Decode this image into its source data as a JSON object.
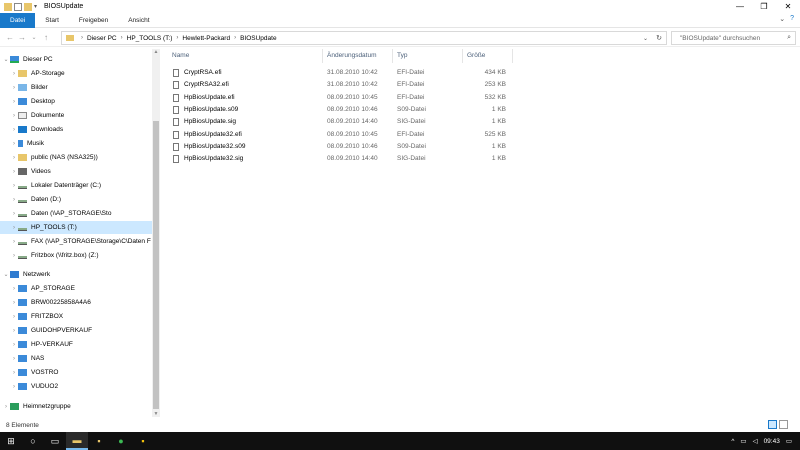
{
  "window": {
    "title": "BIOSUpdate",
    "controls": {
      "minimize": "—",
      "maximize": "❐",
      "close": "✕"
    }
  },
  "ribbon": {
    "tabs": [
      "Datei",
      "Start",
      "Freigeben",
      "Ansicht"
    ],
    "help": "?"
  },
  "address": {
    "crumbs": [
      "Dieser PC",
      "HP_TOOLS (T:)",
      "Hewlett-Packard",
      "BIOSUpdate"
    ],
    "search_placeholder": "\"BIOSUpdate\" durchsuchen"
  },
  "sidebar": {
    "items": [
      {
        "label": "Dieser PC",
        "icon": "pc-icon",
        "level": 0,
        "chev": "⌄"
      },
      {
        "label": "AP-Storage",
        "icon": "folder-icon",
        "level": 1,
        "chev": "›"
      },
      {
        "label": "Bilder",
        "icon": "pictures-icon",
        "level": 1,
        "chev": "›"
      },
      {
        "label": "Desktop",
        "icon": "desktop-icon",
        "level": 1,
        "chev": "›"
      },
      {
        "label": "Dokumente",
        "icon": "documents-icon",
        "level": 1,
        "chev": "›"
      },
      {
        "label": "Downloads",
        "icon": "downloads-icon",
        "level": 1,
        "chev": "›"
      },
      {
        "label": "Musik",
        "icon": "music-icon",
        "level": 1,
        "chev": "›"
      },
      {
        "label": "public (NAS (NSA325))",
        "icon": "network-folder-icon",
        "level": 1,
        "chev": "›"
      },
      {
        "label": "Videos",
        "icon": "videos-icon",
        "level": 1,
        "chev": "›"
      },
      {
        "label": "Lokaler Datenträger (C:)",
        "icon": "drive-icon",
        "level": 1,
        "chev": "›"
      },
      {
        "label": "Daten (D:)",
        "icon": "drive-icon",
        "level": 1,
        "chev": "›"
      },
      {
        "label": "Daten (\\\\AP_STORAGE\\Sto",
        "icon": "network-drive-icon",
        "level": 1,
        "chev": "›"
      },
      {
        "label": "HP_TOOLS (T:)",
        "icon": "drive-icon",
        "level": 1,
        "chev": "›",
        "selected": true
      },
      {
        "label": "FAX (\\\\AP_STORAGE\\Storage\\C\\Daten F",
        "icon": "network-drive-icon",
        "level": 1,
        "chev": "›"
      },
      {
        "label": "Fritzbox (\\\\fritz.box) (Z:)",
        "icon": "network-drive-icon",
        "level": 1,
        "chev": "›"
      },
      {
        "label": "Netzwerk",
        "icon": "network-icon",
        "level": 0,
        "chev": "⌄"
      },
      {
        "label": "AP_STORAGE",
        "icon": "computer-icon",
        "level": 1,
        "chev": "›"
      },
      {
        "label": "BRW00225858A4A6",
        "icon": "computer-icon",
        "level": 1,
        "chev": "›"
      },
      {
        "label": "FRITZBOX",
        "icon": "computer-icon",
        "level": 1,
        "chev": "›"
      },
      {
        "label": "GUIDOHPVERKAUF",
        "icon": "computer-icon",
        "level": 1,
        "chev": "›"
      },
      {
        "label": "HP-VERKAUF",
        "icon": "computer-icon",
        "level": 1,
        "chev": "›"
      },
      {
        "label": "NAS",
        "icon": "computer-icon",
        "level": 1,
        "chev": "›"
      },
      {
        "label": "VOSTRO",
        "icon": "computer-icon",
        "level": 1,
        "chev": "›"
      },
      {
        "label": "VUDUO2",
        "icon": "computer-icon",
        "level": 1,
        "chev": "›"
      },
      {
        "label": "Heimnetzgruppe",
        "icon": "homegroup-icon",
        "level": 0,
        "chev": "›"
      }
    ]
  },
  "files": {
    "columns": {
      "name": "Name",
      "date": "Änderungsdatum",
      "type": "Typ",
      "size": "Größe"
    },
    "rows": [
      {
        "name": "CryptRSA.efi",
        "date": "31.08.2010 10:42",
        "type": "EFI-Datei",
        "size": "434 KB"
      },
      {
        "name": "CryptRSA32.efi",
        "date": "31.08.2010 10:42",
        "type": "EFI-Datei",
        "size": "253 KB"
      },
      {
        "name": "HpBiosUpdate.efi",
        "date": "08.09.2010 10:45",
        "type": "EFI-Datei",
        "size": "532 KB"
      },
      {
        "name": "HpBiosUpdate.s09",
        "date": "08.09.2010 10:46",
        "type": "S09-Datei",
        "size": "1 KB"
      },
      {
        "name": "HpBiosUpdate.sig",
        "date": "08.09.2010 14:40",
        "type": "SIG-Datei",
        "size": "1 KB"
      },
      {
        "name": "HpBiosUpdate32.efi",
        "date": "08.09.2010 10:45",
        "type": "EFI-Datei",
        "size": "525 KB"
      },
      {
        "name": "HpBiosUpdate32.s09",
        "date": "08.09.2010 10:46",
        "type": "S09-Datei",
        "size": "1 KB"
      },
      {
        "name": "HpBiosUpdate32.sig",
        "date": "08.09.2010 14:40",
        "type": "SIG-Datei",
        "size": "1 KB"
      }
    ]
  },
  "status": {
    "count": "8 Elemente"
  },
  "taskbar": {
    "time": "09:43"
  }
}
